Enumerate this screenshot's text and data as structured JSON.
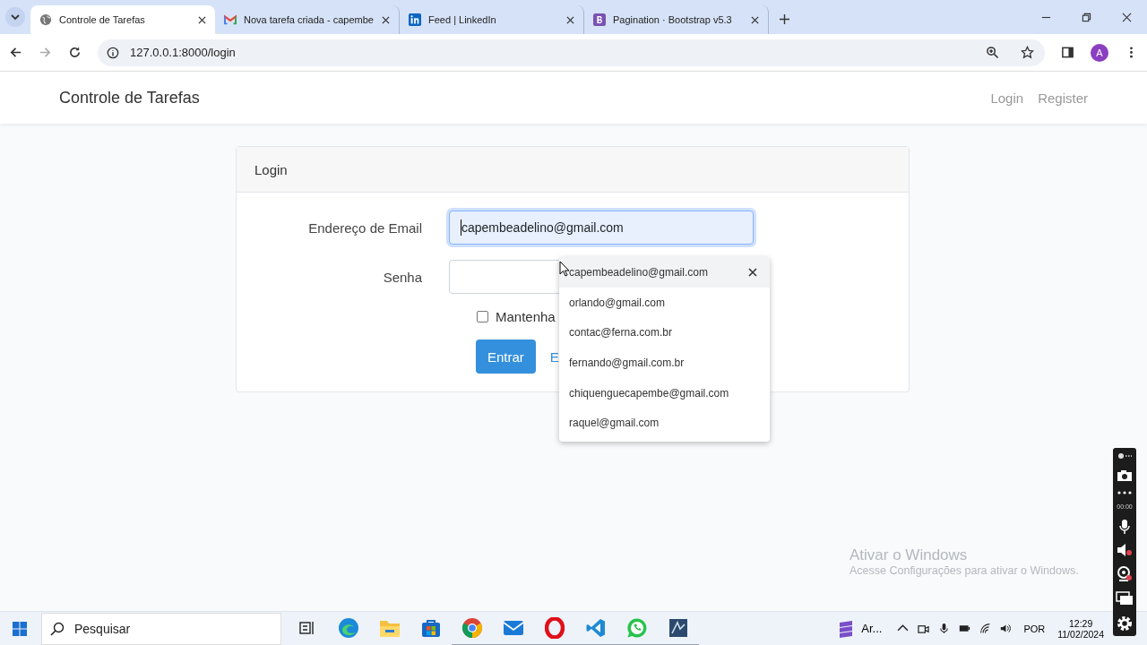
{
  "browser": {
    "tabs": [
      {
        "title": "Controle de Tarefas",
        "kind": "globe",
        "selected": true
      },
      {
        "title": "Nova tarefa criada - capembe",
        "kind": "gmail",
        "selected": false
      },
      {
        "title": "Feed | LinkedIn",
        "kind": "linkedin",
        "selected": false
      },
      {
        "title": "Pagination · Bootstrap v5.3",
        "kind": "bootstrap",
        "selected": false
      }
    ],
    "address": "127.0.0.1:8000/login",
    "profile_initial": "A"
  },
  "navbar": {
    "brand": "Controle de Tarefas",
    "links": [
      "Login",
      "Register"
    ]
  },
  "card": {
    "header": "Login",
    "email": {
      "label": "Endereço de Email",
      "value": "capembeadelino@gmail.com",
      "focused": true
    },
    "password": {
      "label": "Senha"
    },
    "remember": {
      "label": "Mantenha",
      "checked": false
    },
    "submit": "Entrar",
    "link": "E"
  },
  "autocomplete": [
    {
      "text": "capembeadelino@gmail.com",
      "selected": true
    },
    {
      "text": "orlando@gmail.com",
      "selected": false
    },
    {
      "text": "contac@ferna.com.br",
      "selected": false
    },
    {
      "text": "fernando@gmail.com.br",
      "selected": false
    },
    {
      "text": "chiquenguecapembe@gmail.com",
      "selected": false
    },
    {
      "text": "raquel@gmail.com",
      "selected": false
    }
  ],
  "activation": {
    "title": "Ativar o Windows",
    "text": "Acesse Configurações para ativar o Windows."
  },
  "recorder": {
    "timer": "00:00"
  },
  "taskbar": {
    "search_placeholder": "Pesquisar",
    "apps": [
      {
        "kind": "taskview",
        "running": false
      },
      {
        "kind": "edge",
        "running": false
      },
      {
        "kind": "folder",
        "running": false
      },
      {
        "kind": "store",
        "running": false
      },
      {
        "kind": "chrome",
        "running": true
      },
      {
        "kind": "mail",
        "running": true
      },
      {
        "kind": "opera",
        "running": true
      },
      {
        "kind": "vscode",
        "running": true
      },
      {
        "kind": "whatsapp",
        "running": true
      },
      {
        "kind": "tile",
        "running": true
      }
    ],
    "pinned": "Ar...",
    "language": "POR",
    "time": "12:29",
    "date": "11/02/2024"
  }
}
